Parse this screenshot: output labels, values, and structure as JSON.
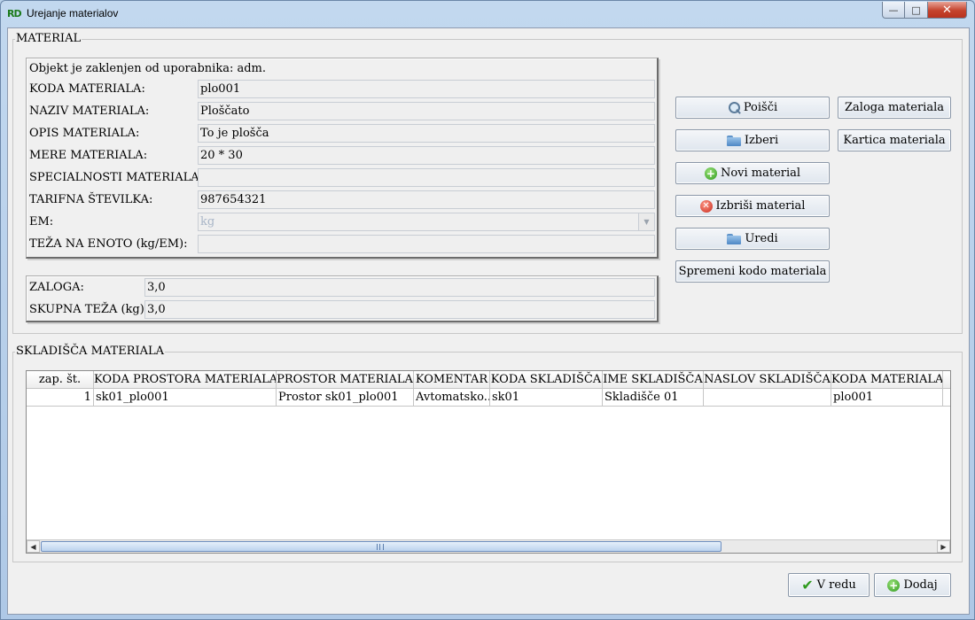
{
  "window": {
    "title": "Urejanje materialov",
    "app_icon_text": "RD",
    "minimize": "—",
    "maximize": "□",
    "close": "✕"
  },
  "material": {
    "group_title": "MATERIAL",
    "lock_notice": "Objekt je zaklenjen od uporabnika: adm.",
    "fields": {
      "koda": {
        "label": "KODA MATERIALA:",
        "value": "plo001"
      },
      "naziv": {
        "label": "NAZIV MATERIALA:",
        "value": "Ploščato"
      },
      "opis": {
        "label": "OPIS MATERIALA:",
        "value": "To je plošča"
      },
      "mere": {
        "label": "MERE MATERIALA:",
        "value": "20 * 30"
      },
      "specialnosti": {
        "label": "SPECIALNOSTI MATERIALA:",
        "value": ""
      },
      "tarifna": {
        "label": "TARIFNA ŠTEVILKA:",
        "value": "987654321"
      },
      "em": {
        "label": "EM:",
        "value": "kg"
      },
      "teza": {
        "label": "TEŽA NA ENOTO (kg/EM):",
        "value": ""
      }
    },
    "stock": {
      "zaloga": {
        "label": "ZALOGA:",
        "value": "3,0"
      },
      "skupna": {
        "label": "SKUPNA TEŽA (kg):",
        "value": "3,0"
      }
    },
    "buttons": {
      "poisci": "Poišči",
      "izberi": "Izberi",
      "novi": "Novi material",
      "izbrisi": "Izbriši material",
      "uredi": "Uredi",
      "spremeni": "Spremeni kodo materiala",
      "zaloga": "Zaloga materiala",
      "kartica": "Kartica materiala"
    }
  },
  "skladisca": {
    "group_title": "SKLADIŠČA MATERIALA",
    "columns": [
      "zap. št.",
      "KODA PROSTORA MATERIALA",
      "PROSTOR MATERIALA",
      "KOMENTAR",
      "KODA SKLADIŠČA",
      "IME SKLADIŠČA",
      "NASLOV SKLADIŠČA",
      "KODA MATERIALA"
    ],
    "rows": [
      [
        "1",
        "sk01_plo001",
        "Prostor sk01_plo001",
        "Avtomatsko...",
        "sk01",
        "Skladišče 01",
        "",
        "plo001"
      ]
    ]
  },
  "footer": {
    "ok": "V redu",
    "add": "Dodaj"
  }
}
